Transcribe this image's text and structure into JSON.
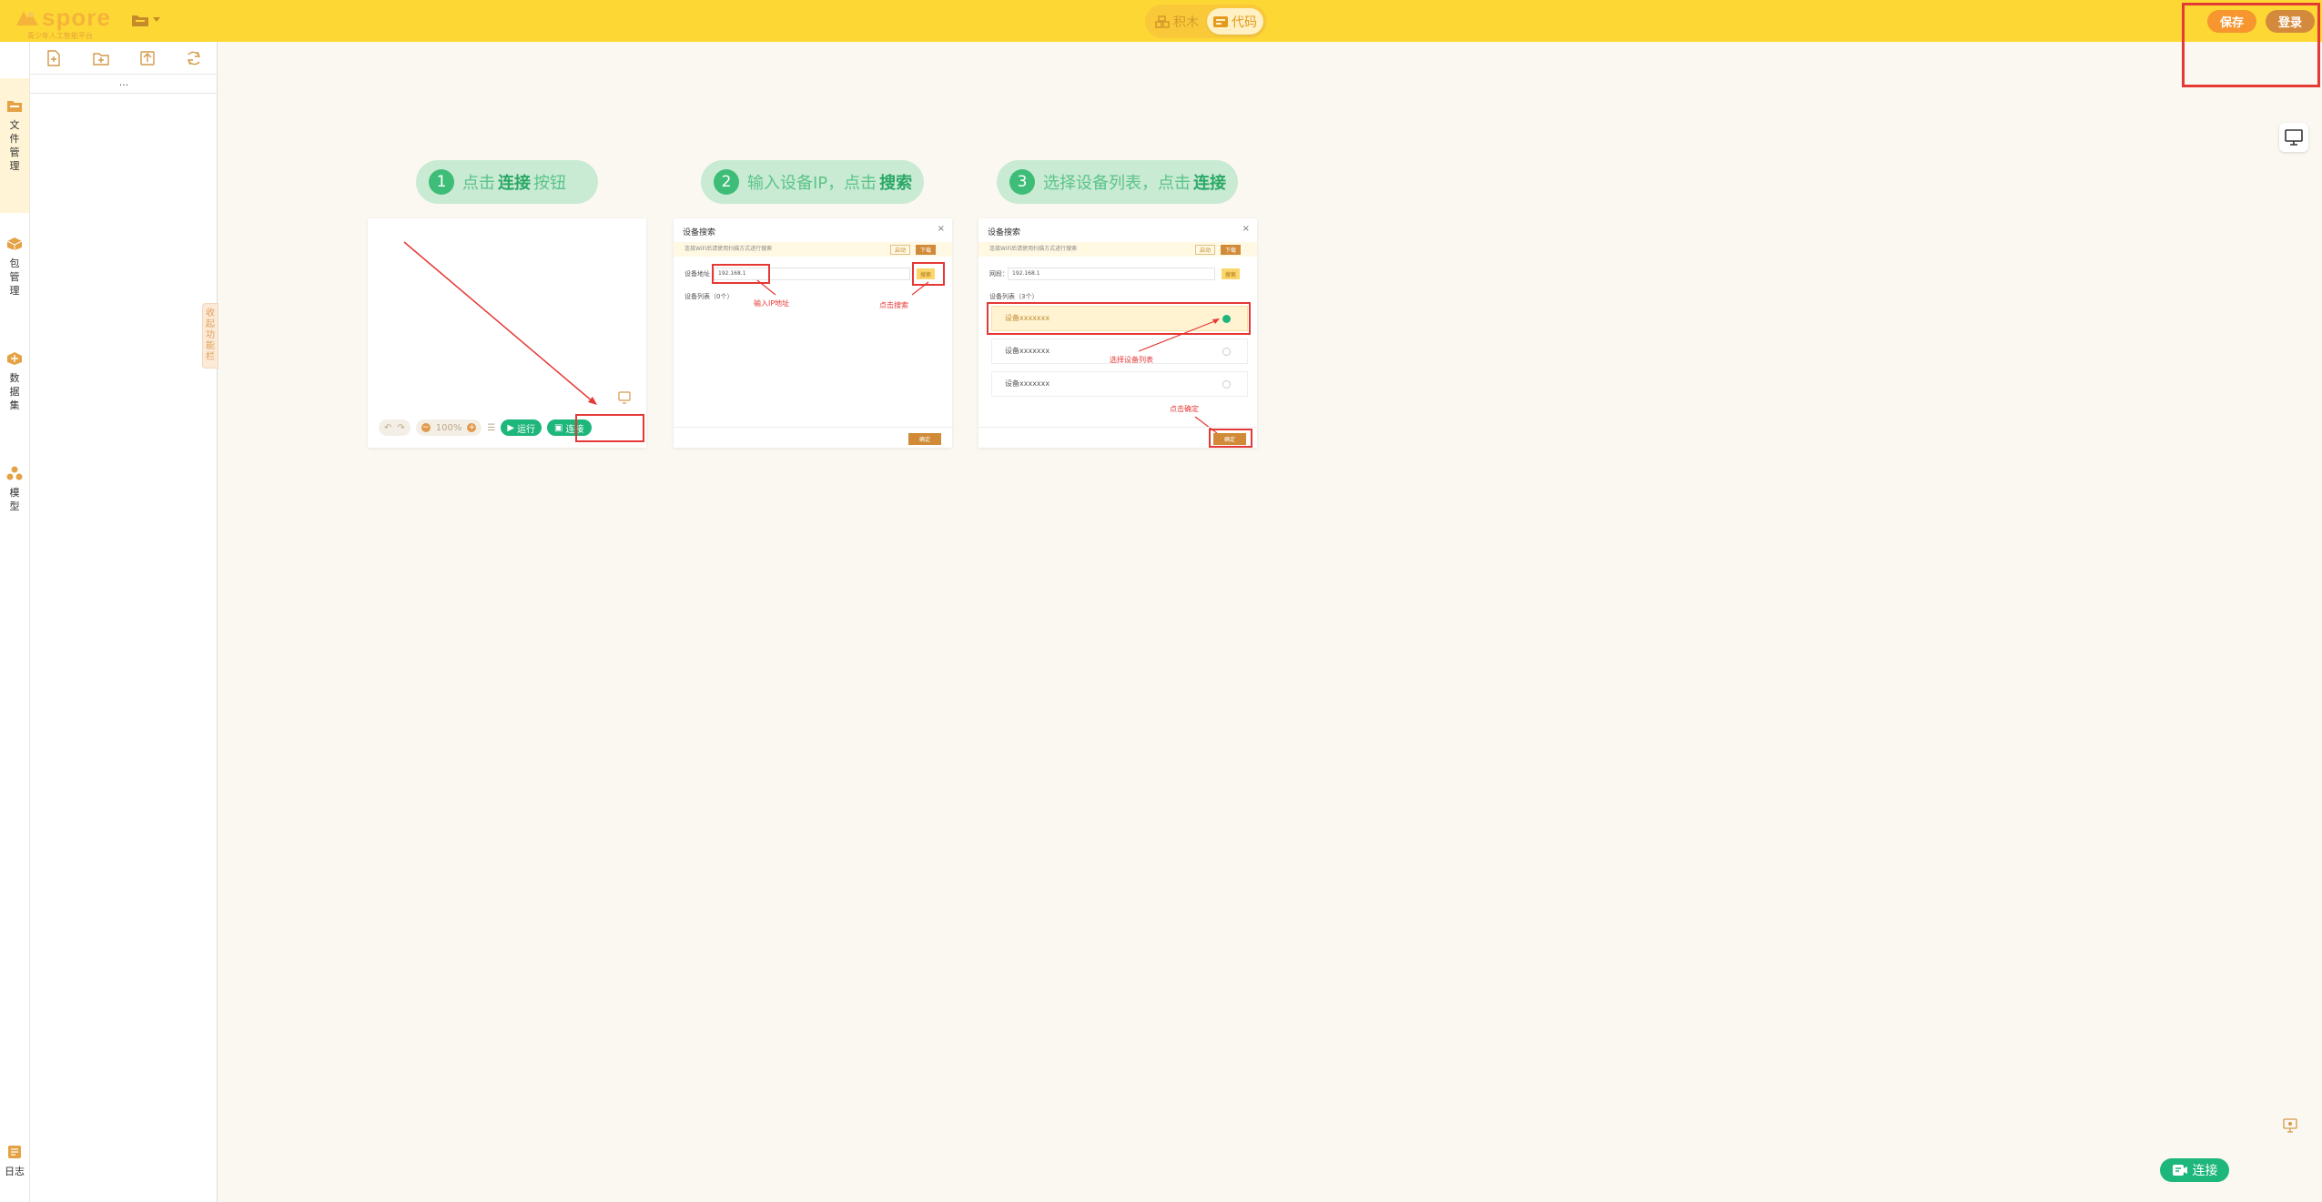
{
  "header": {
    "logo_text": "spore",
    "logo_sub": "青少年人工智能平台",
    "mode_blocks": "积木",
    "mode_code": "代码",
    "save_label": "保存",
    "login_label": "登录"
  },
  "rail": {
    "items": [
      {
        "label_chars": [
          "文",
          "件",
          "管",
          "理"
        ],
        "icon": "folder-icon"
      },
      {
        "label_chars": [
          "包",
          "管",
          "理"
        ],
        "icon": "package-icon"
      },
      {
        "label_chars": [
          "数",
          "据",
          "集"
        ],
        "icon": "dataset-icon"
      },
      {
        "label_chars": [
          "模",
          "型"
        ],
        "icon": "model-icon"
      }
    ],
    "log_label": "日志"
  },
  "filepanel": {
    "dots": "...",
    "collapse_chars": [
      "收",
      "起",
      "功",
      "能",
      "栏"
    ]
  },
  "steps": [
    {
      "num": "1",
      "pre": "点击",
      "bold": "连接",
      "post": "按钮"
    },
    {
      "num": "2",
      "pre": "输入设备IP，点击",
      "bold": "搜索",
      "post": ""
    },
    {
      "num": "3",
      "pre": "选择设备列表，点击",
      "bold": "连接",
      "post": ""
    }
  ],
  "card1": {
    "zoom": "100%",
    "run_label": "运行",
    "connect_label": "连接"
  },
  "card2": {
    "title": "设备搜索",
    "close": "×",
    "notice": "连接WiFi后请使用扫描方式进行搜索",
    "btn_a": "启动",
    "btn_b": "下载",
    "ip_label": "设备地址",
    "ip_value": "192.168.1",
    "search": "搜索",
    "list_label": "设备列表（0个）",
    "annot_ip": "输入IP地址",
    "annot_search": "点击搜索",
    "ok": "确定"
  },
  "card3": {
    "title": "设备搜索",
    "close": "×",
    "notice": "连接WiFi后请使用扫描方式进行搜索",
    "btn_a": "启动",
    "btn_b": "下载",
    "ip_label": "网段：",
    "ip_value": "192.168.1",
    "search": "搜索",
    "list_label": "设备列表（3个）",
    "devices": [
      "设备xxxxxxx",
      "设备xxxxxxx",
      "设备xxxxxxx"
    ],
    "annot_select": "选择设备列表",
    "annot_ok": "点击确定",
    "ok": "确定"
  },
  "fab": {
    "connect_label": "连接"
  }
}
